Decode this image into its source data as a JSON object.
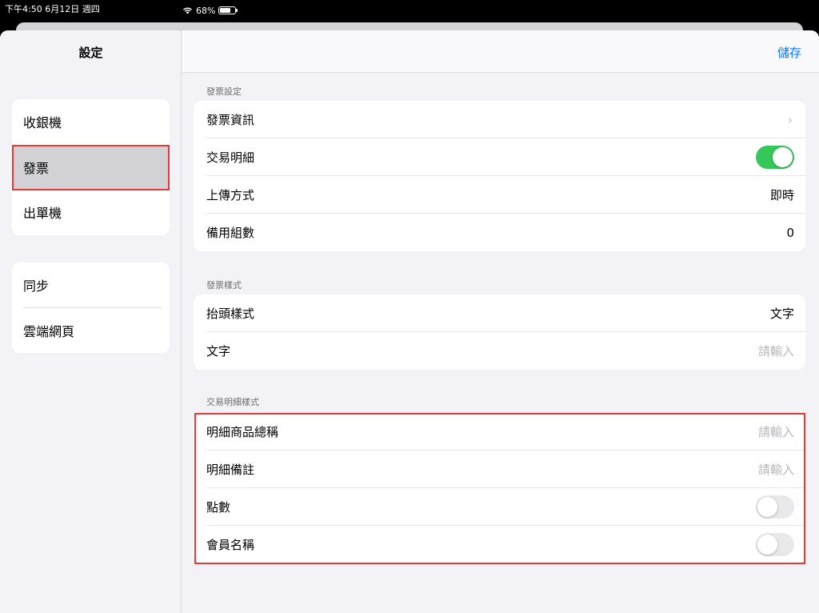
{
  "statusbar": {
    "time": "下午4:50  6月12日 週四",
    "battery": "68%"
  },
  "sidebar": {
    "title": "設定",
    "groups": [
      {
        "items": [
          {
            "label": "收銀機"
          },
          {
            "label": "發票"
          },
          {
            "label": "出單機"
          }
        ]
      },
      {
        "items": [
          {
            "label": "同步"
          },
          {
            "label": "雲端網頁"
          }
        ]
      }
    ],
    "selected": "發票"
  },
  "navbar": {
    "save_label": "儲存"
  },
  "sections": [
    {
      "header": "發票設定",
      "rows": [
        {
          "label": "發票資訊",
          "type": "chevron"
        },
        {
          "label": "交易明細",
          "type": "toggle",
          "on": true
        },
        {
          "label": "上傳方式",
          "type": "value",
          "value": "即時"
        },
        {
          "label": "備用組數",
          "type": "value",
          "value": "0"
        }
      ]
    },
    {
      "header": "發票樣式",
      "rows": [
        {
          "label": "抬頭樣式",
          "type": "value",
          "value": "文字"
        },
        {
          "label": "文字",
          "type": "input",
          "placeholder": "請輸入"
        }
      ]
    },
    {
      "header": "交易明細樣式",
      "rows": [
        {
          "label": "明細商品總稱",
          "type": "input",
          "placeholder": "請輸入"
        },
        {
          "label": "明細備註",
          "type": "input",
          "placeholder": "請輸入"
        },
        {
          "label": "點數",
          "type": "toggle",
          "on": false
        },
        {
          "label": "會員名稱",
          "type": "toggle",
          "on": false
        }
      ]
    }
  ],
  "colors": {
    "accent": "#007aff",
    "toggle_on": "#34c759",
    "highlight": "#e53935"
  },
  "icons": {
    "wifi": "wifi-icon",
    "battery": "battery-icon",
    "chevron": "chevron-right-icon"
  }
}
